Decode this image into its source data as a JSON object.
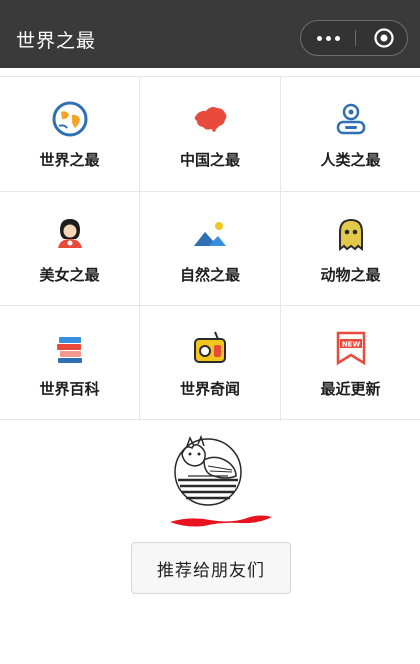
{
  "app": {
    "title": "世界之最"
  },
  "menu": {
    "more_icon": "more-dots-icon",
    "close_icon": "target-circle-icon"
  },
  "grid": {
    "items": [
      {
        "label": "世界之最",
        "icon": "globe-icon"
      },
      {
        "label": "中国之最",
        "icon": "china-map-icon"
      },
      {
        "label": "人类之最",
        "icon": "person-icon"
      },
      {
        "label": "美女之最",
        "icon": "woman-icon"
      },
      {
        "label": "自然之最",
        "icon": "landscape-icon"
      },
      {
        "label": "动物之最",
        "icon": "ghost-animal-icon"
      },
      {
        "label": "世界百科",
        "icon": "books-icon"
      },
      {
        "label": "世界奇闻",
        "icon": "radio-icon"
      },
      {
        "label": "最近更新",
        "icon": "new-badge-icon",
        "badge": "NEW"
      }
    ]
  },
  "footer": {
    "share_label": "推荐给朋友们"
  },
  "colors": {
    "nav_bg": "#3a3a3a",
    "accent_red": "#e84b3c",
    "accent_blue": "#2f6fb3",
    "accent_yellow": "#f3c51f"
  }
}
